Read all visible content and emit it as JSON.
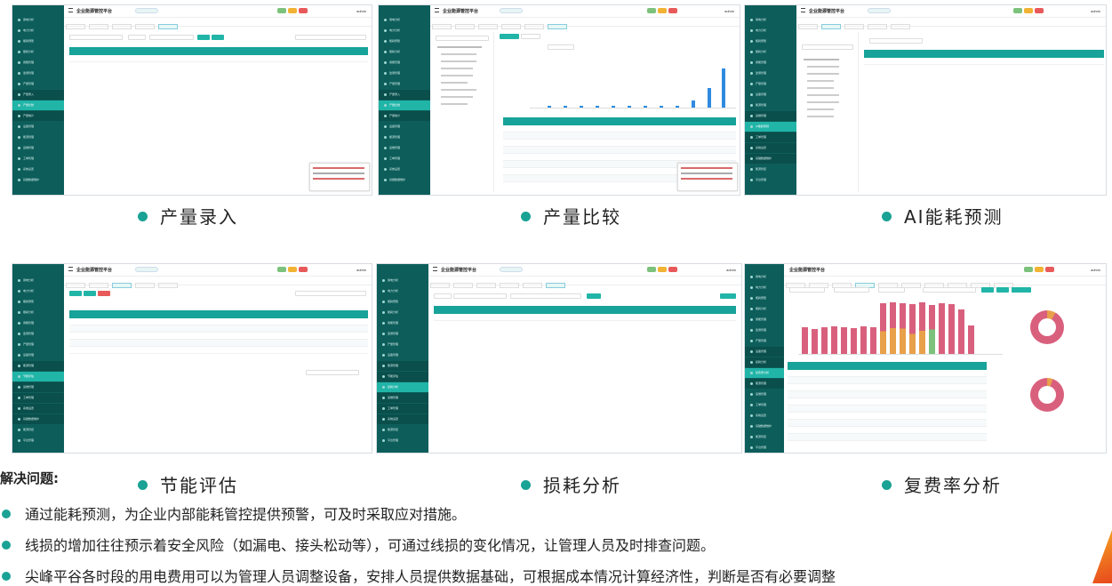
{
  "app_title": "企业能源管控平台",
  "factory_label": "测量工厂电气所属",
  "user_name": "admin",
  "sidebar": {
    "items": [
      "用电分析",
      "电力分析",
      "能耗预警",
      "能耗分析",
      "用能管理",
      "监测管理",
      "产量管理",
      "产量录入",
      "产量比较",
      "产量统计",
      "设备管理",
      "能源管理",
      "运维管理",
      "工单管理",
      "系统设置",
      "基础数据维护",
      "能源管控",
      "平台管理"
    ]
  },
  "captions": {
    "s1": "产量录入",
    "s2": "产量比较",
    "s3": "AI能耗预测",
    "s4": "节能评估",
    "s5": "损耗分析",
    "s6": "复费率分析"
  },
  "notes": {
    "title": "解决问题:",
    "items": [
      "通过能耗预测，为企业内部能耗管控提供预警，可及时采取应对措施。",
      "线损的增加往往预示着安全风险（如漏电、接头松动等），可通过线损的变化情况，让管理人员及时排查问题。",
      "尖峰平谷各时段的用电费用可以为管理人员调整设备，安排人员提供数据基础，可根据成本情况计算经济性，判断是否有必要调整"
    ]
  },
  "colors": {
    "sidebar": "#0d5e5b",
    "accent": "#1aa295",
    "header_row": "#17a399",
    "chart_blue": "#2f8ae0",
    "chart_pink": "#d9607d",
    "chart_orange": "#e8a04a",
    "chart_green": "#7cc27c"
  }
}
